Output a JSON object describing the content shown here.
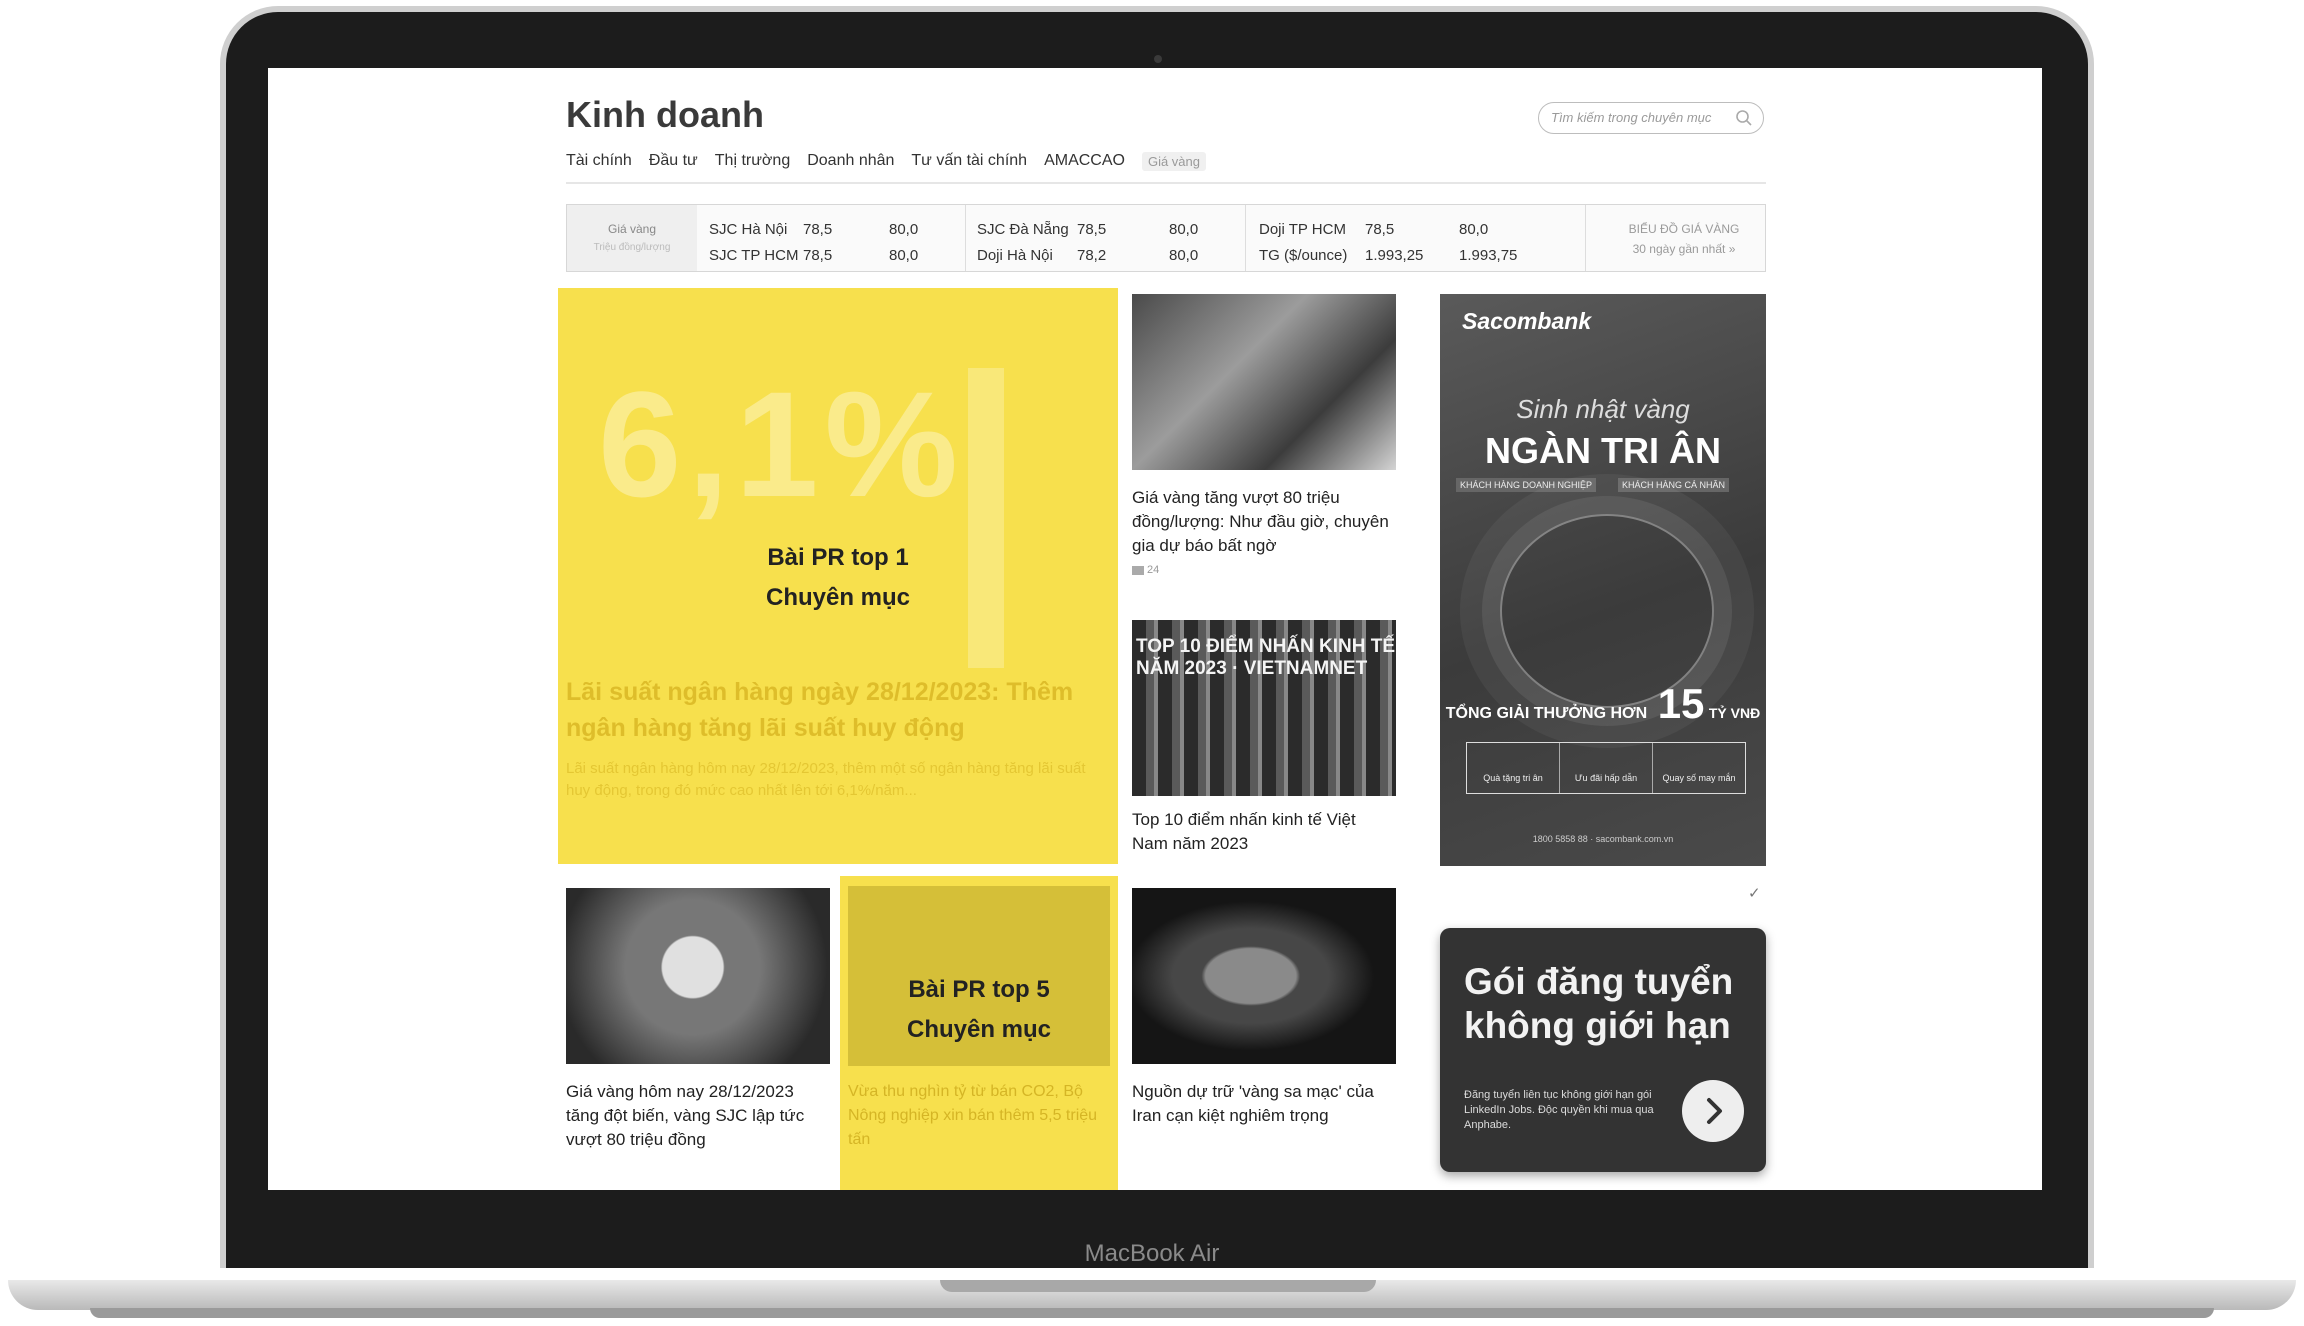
{
  "device": {
    "label": "MacBook Air"
  },
  "header": {
    "title": "Kinh doanh",
    "search_placeholder": "Tìm kiếm trong chuyên mục"
  },
  "nav": [
    {
      "label": "Tài chính"
    },
    {
      "label": "Đầu tư"
    },
    {
      "label": "Thị trường"
    },
    {
      "label": "Doanh nhân"
    },
    {
      "label": "Tư vấn tài chính"
    },
    {
      "label": "AMACCAO"
    },
    {
      "label": "Giá vàng"
    }
  ],
  "gold": {
    "label": "Giá vàng",
    "unit": "Triệu đồng/lượng",
    "rows": [
      {
        "name": "SJC Hà Nội",
        "buy": "78,5",
        "sell": "80,0"
      },
      {
        "name": "SJC TP HCM",
        "buy": "78,5",
        "sell": "80,0"
      },
      {
        "name": "SJC Đà Nẵng",
        "buy": "78,5",
        "sell": "80,0"
      },
      {
        "name": "Doji Hà Nội",
        "buy": "78,2",
        "sell": "80,0"
      },
      {
        "name": "Doji TP HCM",
        "buy": "78,5",
        "sell": "80,0"
      },
      {
        "name": "TG ($/ounce)",
        "buy": "1.993,25",
        "sell": "1.993,75"
      }
    ],
    "chart_link_line1": "BIỂU ĐỒ GIÁ VÀNG",
    "chart_link_line2": "30 ngày gần nhất »"
  },
  "pr_top1": {
    "label_line1": "Bài PR top 1",
    "label_line2": "Chuyên mục",
    "bg_number": "6,1%",
    "faded_title": "Lãi suất ngân hàng ngày 28/12/2023: Thêm ngân hàng tăng lãi suất huy động",
    "faded_text": "Lãi suất ngân hàng hôm nay 28/12/2023, thêm một số ngân hàng tăng lãi suất huy động, trong đó mức cao nhất lên tới 6,1%/năm..."
  },
  "articles": [
    {
      "title": "Giá vàng tăng vượt 80 triệu đồng/lượng: Như đầu giờ, chuyên gia dự báo bất ngờ",
      "comments": "24"
    },
    {
      "title": "Top 10 điểm nhấn kinh tế Việt Nam năm 2023",
      "image_caption": "TOP 10 ĐIỂM NHẤN KINH TẾ NĂM 2023 · VIETNAMNET"
    },
    {
      "title": "Giá vàng hôm nay 28/12/2023 tăng đột biến, vàng SJC lập tức vượt 80 triệu đồng"
    },
    {
      "title": "Nguồn dự trữ 'vàng sa mạc' của Iran cạn kiệt nghiêm trọng"
    }
  ],
  "pr_top5": {
    "label_line1": "Bài PR top 5",
    "label_line2": "Chuyên mục",
    "faded_title": "Vừa thu nghìn tỷ từ bán CO2, Bộ Nông nghiệp xin bán thêm 5,5 triệu tấn"
  },
  "ad_sacombank": {
    "brand": "Sacombank",
    "script": "Sinh nhật vàng",
    "headline": "NGÀN TRI ÂN",
    "tag_left": "KHÁCH HÀNG DOANH NGHIỆP",
    "tag_right": "KHÁCH HÀNG CÁ NHÂN",
    "prize_prefix": "TỔNG GIẢI THƯỞNG HƠN",
    "prize_value": "15",
    "prize_unit": "TỶ VNĐ",
    "box1": "Quà tặng tri ân",
    "box2": "Ưu đãi hấp dẫn",
    "box3": "Quay số may mắn",
    "contact": "1800 5858 88 · sacombank.com.vn"
  },
  "ad_jobs": {
    "title": "Gói đăng tuyển không giới hạn",
    "text": "Đăng tuyển liên tục không giới hạn gói LinkedIn Jobs. Độc quyền khi mua qua Anphabe."
  },
  "colors": {
    "pr_yellow": "#f7e04d",
    "ad_dark": "#333333"
  }
}
